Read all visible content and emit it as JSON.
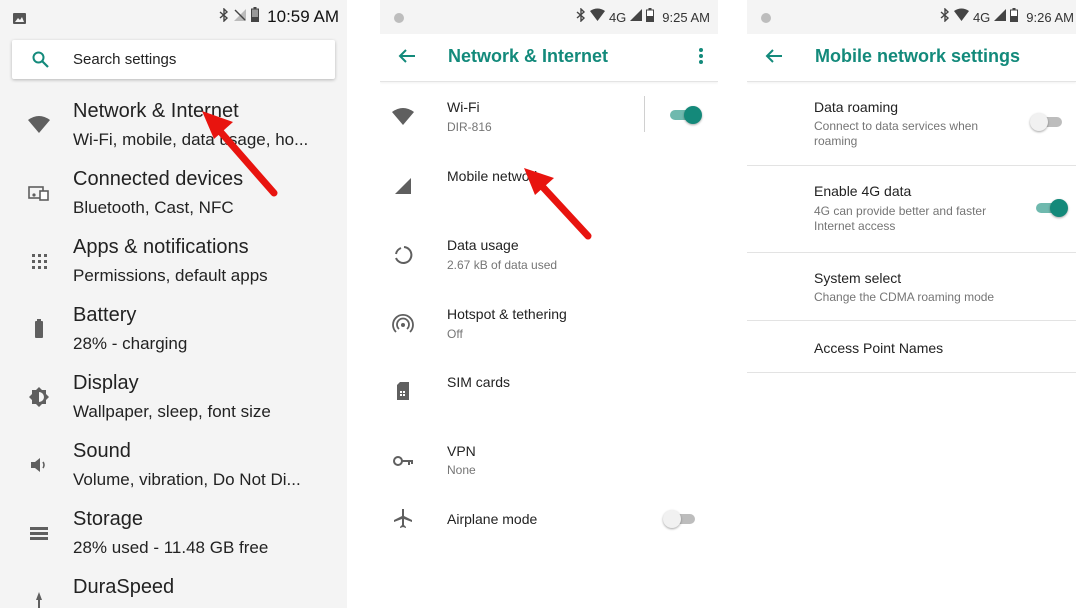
{
  "colors": {
    "accent": "#138a7b",
    "arrow": "#e8140f",
    "icon": "#5f5f5f"
  },
  "panel1": {
    "status": {
      "time": "10:59 AM"
    },
    "search": {
      "icon": "search-icon",
      "label": "Search settings"
    },
    "items": [
      {
        "title": "Network & Internet",
        "subtitle": "Wi-Fi, mobile, data usage, ho...",
        "icon": "wifi-icon"
      },
      {
        "title": "Connected devices",
        "subtitle": "Bluetooth, Cast, NFC",
        "icon": "devices-icon"
      },
      {
        "title": "Apps & notifications",
        "subtitle": "Permissions, default apps",
        "icon": "apps-icon"
      },
      {
        "title": "Battery",
        "subtitle": "28% - charging",
        "icon": "battery-icon"
      },
      {
        "title": "Display",
        "subtitle": "Wallpaper, sleep, font size",
        "icon": "display-icon"
      },
      {
        "title": "Sound",
        "subtitle": "Volume, vibration, Do Not Di...",
        "icon": "volume-icon"
      },
      {
        "title": "Storage",
        "subtitle": "28% used - 11.48 GB free",
        "icon": "storage-icon"
      },
      {
        "title": "DuraSpeed",
        "subtitle": "",
        "icon": "speed-icon"
      }
    ]
  },
  "panel2": {
    "status": {
      "network": "4G",
      "time": "9:25 AM"
    },
    "title": "Network & Internet",
    "items": [
      {
        "title": "Wi-Fi",
        "subtitle": "DIR-816",
        "icon": "wifi-icon",
        "toggle": true
      },
      {
        "title": "Mobile network",
        "subtitle": "",
        "icon": "signal-icon"
      },
      {
        "title": "Data usage",
        "subtitle": "2.67 kB of data used",
        "icon": "data-usage-icon"
      },
      {
        "title": "Hotspot & tethering",
        "subtitle": "Off",
        "icon": "hotspot-icon"
      },
      {
        "title": "SIM cards",
        "subtitle": "",
        "icon": "sim-card-icon"
      },
      {
        "title": "VPN",
        "subtitle": "None",
        "icon": "vpn-key-icon"
      },
      {
        "title": "Airplane mode",
        "subtitle": "",
        "icon": "airplane-icon",
        "toggle": false
      }
    ]
  },
  "panel3": {
    "status": {
      "network": "4G",
      "time": "9:26 AM"
    },
    "title": "Mobile network settings",
    "items": [
      {
        "title": "Data roaming",
        "subtitle": "Connect to data services when roaming",
        "toggle": false
      },
      {
        "title": "Enable 4G data",
        "subtitle": "4G can provide better and faster Internet access",
        "toggle": true
      },
      {
        "title": "System select",
        "subtitle": "Change the CDMA roaming mode"
      },
      {
        "title": "Access Point Names",
        "subtitle": ""
      }
    ]
  }
}
